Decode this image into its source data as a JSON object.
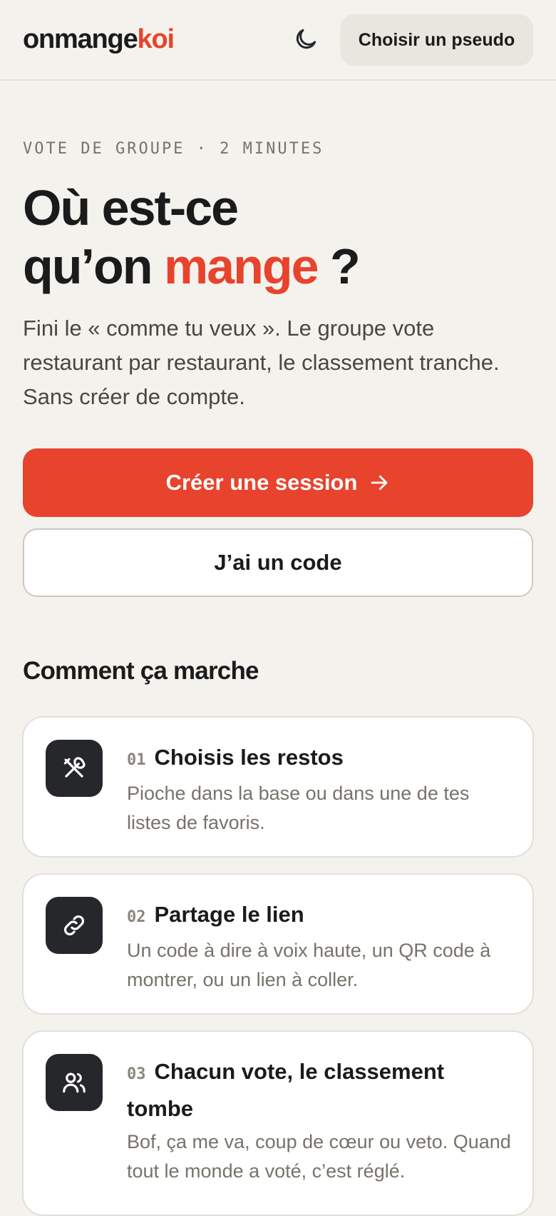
{
  "header": {
    "logo_main": "onmange",
    "logo_accent": "koi",
    "theme_icon": "moon-icon",
    "pseudo_button": "Choisir un pseudo"
  },
  "hero": {
    "eyebrow": "VOTE DE GROUPE · 2 MINUTES",
    "title_line1": "Où est-ce",
    "title_line2_before": "qu’on ",
    "title_accent": "mange",
    "title_line2_after": " ?",
    "subtitle": "Fini le « comme tu veux ». Le groupe vote restaurant par restaurant, le classement tranche. Sans créer de compte.",
    "cta_primary": "Créer une session",
    "cta_primary_icon": "arrow-right-icon",
    "cta_secondary": "J’ai un code"
  },
  "how": {
    "title": "Comment ça marche",
    "steps": [
      {
        "num": "01",
        "title": "Choisis les restos",
        "desc": "Pioche dans la base ou dans une de tes listes de favoris.",
        "icon": "utensils-icon"
      },
      {
        "num": "02",
        "title": "Partage le lien",
        "desc": "Un code à dire à voix haute, un QR code à montrer, ou un lien à coller.",
        "icon": "link-icon"
      },
      {
        "num": "03",
        "title": "Chacun vote, le classement tombe",
        "desc": "Bof, ça me va, coup de cœur ou veto. Quand tout le monde a voté, c’est réglé.",
        "icon": "users-icon"
      }
    ]
  },
  "colors": {
    "accent": "#e8432d",
    "background": "#f4f2ed",
    "icon_tile": "#26272b"
  }
}
